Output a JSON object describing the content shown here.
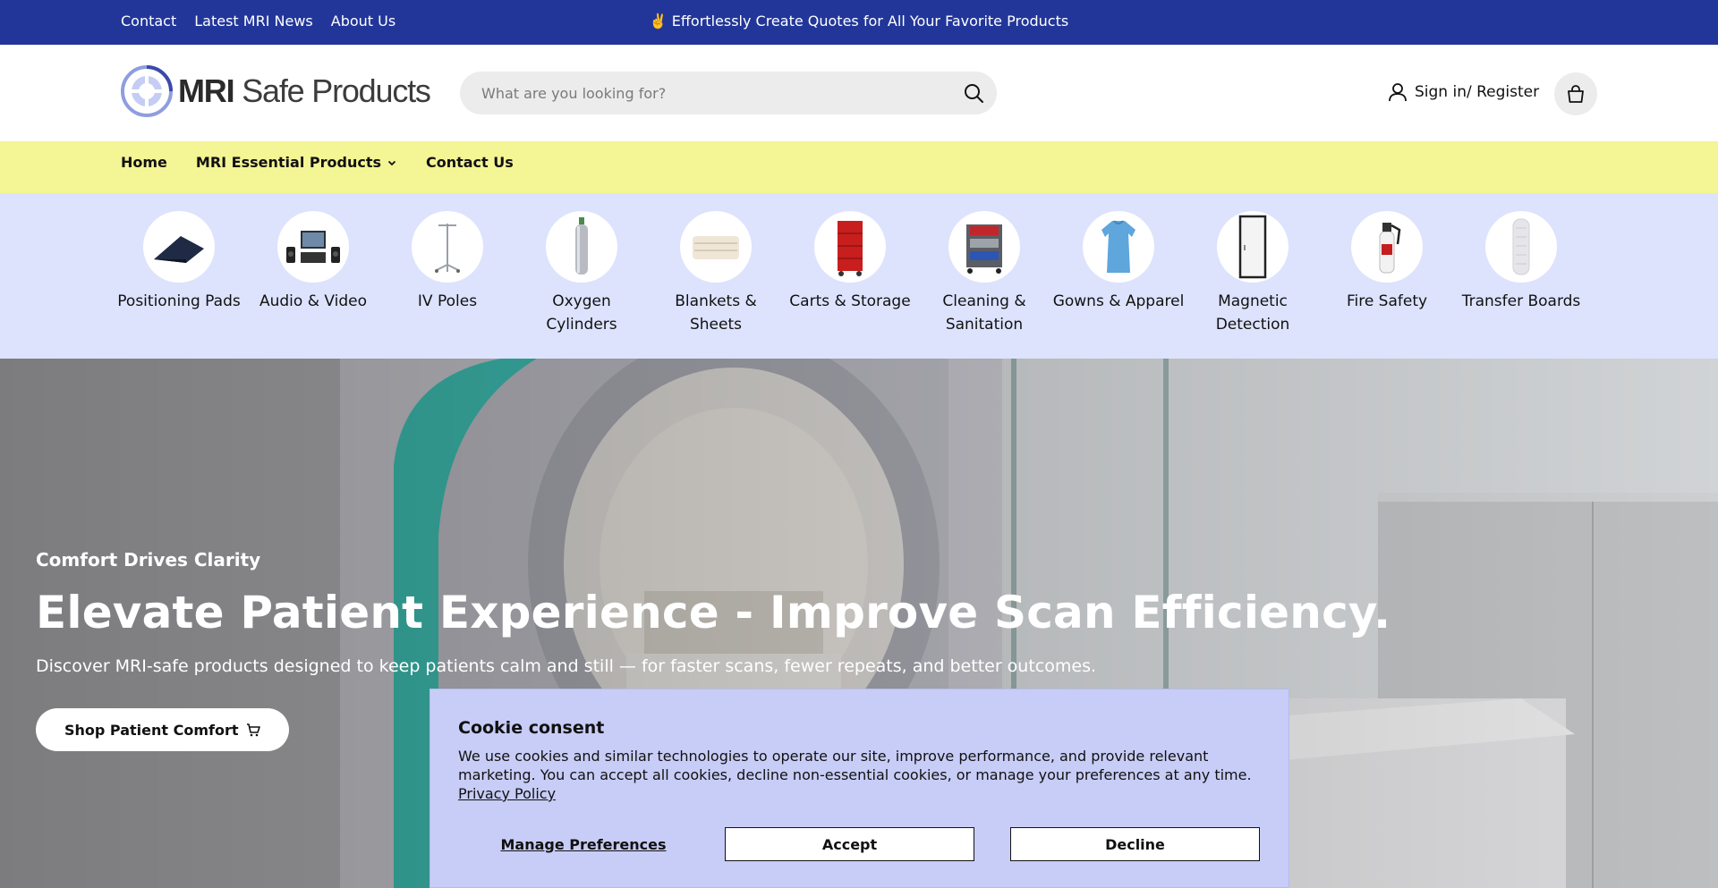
{
  "topbar": {
    "links": [
      "Contact",
      "Latest MRI News",
      "About Us"
    ],
    "promo": "✌️ Effortlessly Create Quotes for All Your Favorite Products"
  },
  "header": {
    "logo_bold": "MRI",
    "logo_light": "Safe Products",
    "search_placeholder": "What are you looking for?",
    "account_label": "Sign in/ Register"
  },
  "nav": {
    "home": "Home",
    "essential": "MRI Essential Products",
    "contact": "Contact Us"
  },
  "categories": [
    {
      "label": "Positioning Pads",
      "icon": "positioning-pad"
    },
    {
      "label": "Audio & Video",
      "icon": "audio-video"
    },
    {
      "label": "IV Poles",
      "icon": "iv-pole"
    },
    {
      "label": "Oxygen Cylinders",
      "icon": "oxygen-cylinder"
    },
    {
      "label": "Blankets & Sheets",
      "icon": "blanket"
    },
    {
      "label": "Carts & Storage",
      "icon": "cart-storage"
    },
    {
      "label": "Cleaning & Sanitation",
      "icon": "cleaning-cart"
    },
    {
      "label": "Gowns & Apparel",
      "icon": "gown"
    },
    {
      "label": "Magnetic Detection",
      "icon": "magnetic-detector"
    },
    {
      "label": "Fire Safety",
      "icon": "fire-extinguisher"
    },
    {
      "label": "Transfer Boards",
      "icon": "transfer-board"
    }
  ],
  "hero": {
    "subtitle": "Comfort Drives Clarity",
    "title": "Elevate Patient Experience - Improve Scan Efficiency.",
    "description": "Discover MRI-safe products designed to keep patients calm and still — for faster scans, fewer repeats, and better outcomes.",
    "cta": "Shop Patient Comfort"
  },
  "cookie": {
    "title": "Cookie consent",
    "body": "We use cookies and similar technologies to operate our site, improve performance, and provide relevant marketing. You can accept all cookies, decline non-essential cookies, or manage your preferences at any time.",
    "policy_link": "Privacy Policy",
    "manage": "Manage Preferences",
    "accept": "Accept",
    "decline": "Decline"
  },
  "colors": {
    "topbar": "#22369a",
    "nav": "#f4f594",
    "categories": "#dde3fd",
    "cookie": "#c8cdf7"
  }
}
